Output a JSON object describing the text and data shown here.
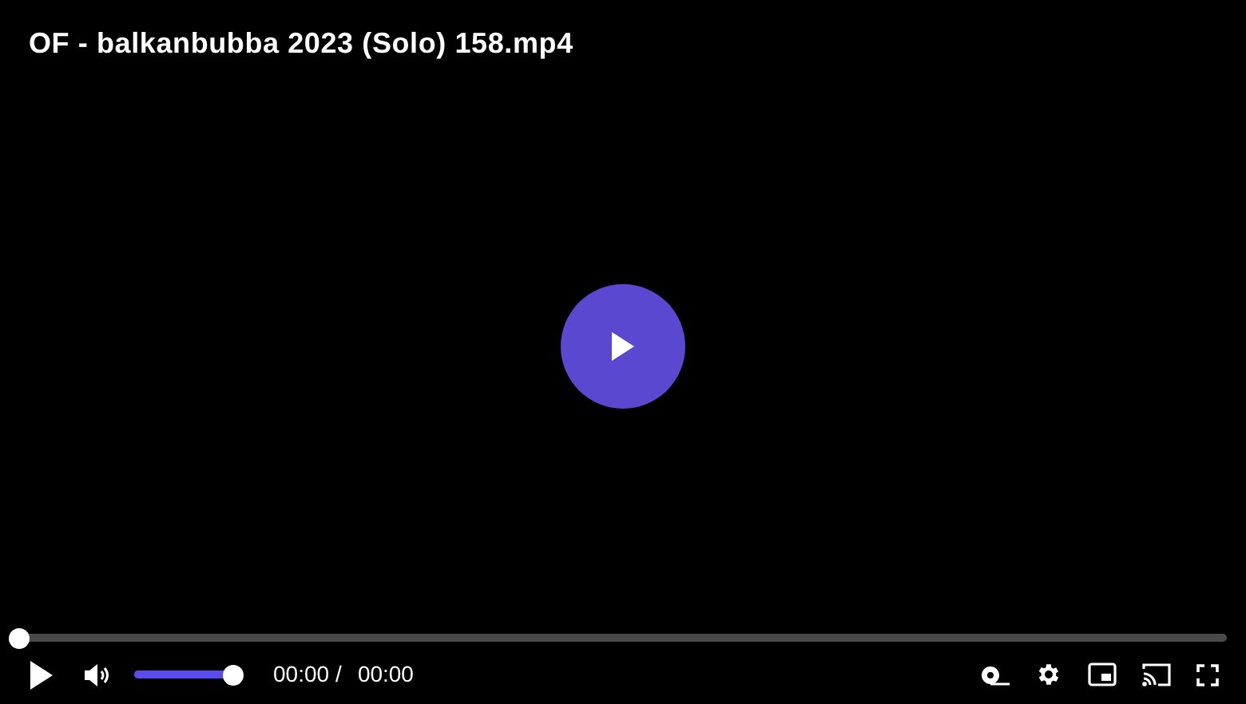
{
  "title": "OF - balkanbubba 2023 (Solo) 158.mp4",
  "progress": {
    "level": 0
  },
  "volume": {
    "level": 1
  },
  "time": {
    "current": "00:00",
    "separator": "/",
    "duration": "00:00"
  }
}
